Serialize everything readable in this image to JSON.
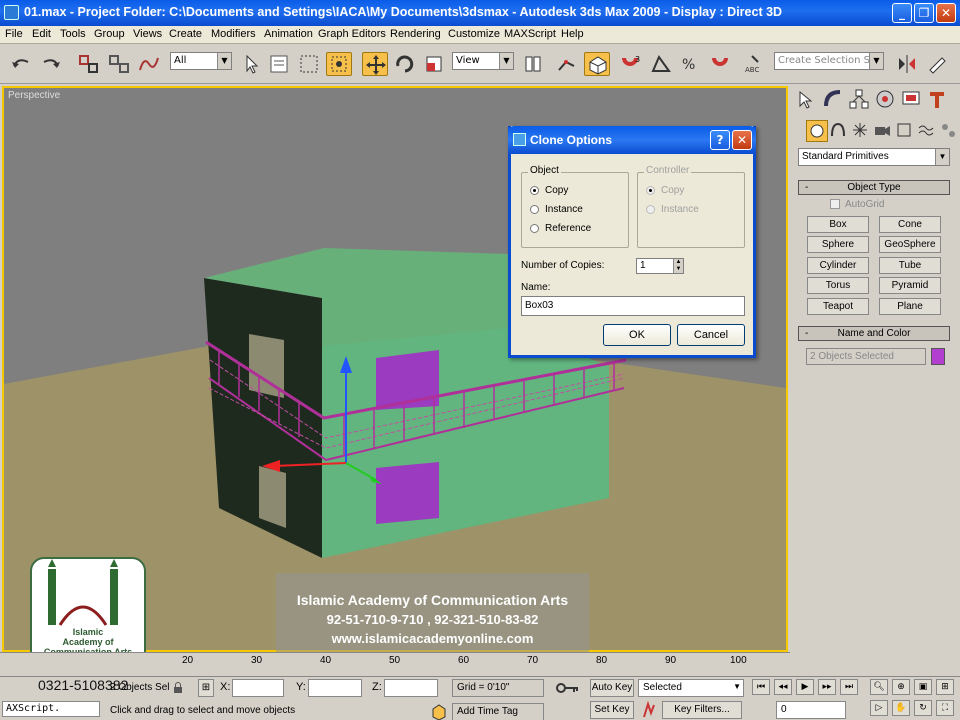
{
  "window": {
    "title": "01.max    - Project Folder: C:\\Documents and Settings\\IACA\\My Documents\\3dsmax    - Autodesk 3ds Max  2009        - Display : Direct 3D",
    "minimize": "_",
    "maximize": "❐",
    "close": "✕"
  },
  "menu": [
    "File",
    "Edit",
    "Tools",
    "Group",
    "Views",
    "Create",
    "Modifiers",
    "Animation",
    "Graph Editors",
    "Rendering",
    "Customize",
    "MAXScript",
    "Help"
  ],
  "toolbar": {
    "filter_value": "All",
    "refcoord_value": "View",
    "selection_set_placeholder": "Create Selection Se"
  },
  "viewport": {
    "label": "Perspective"
  },
  "command_panel": {
    "category_dropdown": "Standard Primitives",
    "object_type_header": "Object Type",
    "autogrid_label": "AutoGrid",
    "primitives": [
      "Box",
      "Cone",
      "Sphere",
      "GeoSphere",
      "Cylinder",
      "Tube",
      "Torus",
      "Pyramid",
      "Teapot",
      "Plane"
    ],
    "name_color_header": "Name and Color",
    "name_value": "2 Objects Selected",
    "swatch_color": "#b23fd0"
  },
  "dialog": {
    "title": "Clone Options",
    "help_btn": "?",
    "close_btn": "✕",
    "object_group": "Object",
    "object_options": [
      "Copy",
      "Instance",
      "Reference"
    ],
    "object_selected": "Copy",
    "controller_group": "Controller",
    "controller_options": [
      "Copy",
      "Instance"
    ],
    "copies_label": "Number of Copies:",
    "copies_value": "1",
    "name_label": "Name:",
    "name_value": "Box03",
    "ok_label": "OK",
    "cancel_label": "Cancel"
  },
  "timeline": {
    "ticks": [
      "20",
      "30",
      "40",
      "50",
      "60",
      "70",
      "80",
      "90",
      "100"
    ]
  },
  "status": {
    "selection_text": "2 Objects Sel",
    "x_label": "X:",
    "y_label": "Y:",
    "z_label": "Z:",
    "grid_text": "Grid = 0'10\"",
    "autokey_label": "Auto Key",
    "autokey_value": "Selected",
    "setkey_label": "Set Key",
    "keyfilters_label": "Key Filters...",
    "frame_value": "0",
    "prompt": "Click and drag to select and move objects",
    "add_time_tag": "Add Time Tag",
    "maxscript": "AXScript."
  },
  "watermark": {
    "line1": "Islamic Academy of Communication Arts",
    "line2": "92-51-710-9-710 , 92-321-510-83-82",
    "line3": "www.islamicacademyonline.com",
    "phone": "0321-5108382",
    "logo_text_1": "Islamic",
    "logo_text_2": "Academy of",
    "logo_text_3": "Communication Arts"
  }
}
